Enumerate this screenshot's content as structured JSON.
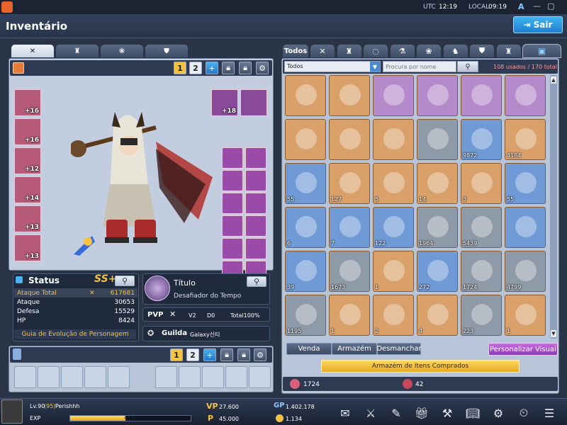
{
  "topbar": {
    "utc_label": "UTC",
    "utc_time": "12:19",
    "local_label": "LOCAL",
    "local_time": "09:19",
    "font_btn": "A"
  },
  "header": {
    "title": "Inventário",
    "exit_label": "Sair"
  },
  "equip": {
    "tabs": [
      "sword-icon",
      "armor-icon",
      "paw-icon",
      "shield-icon"
    ],
    "pages": [
      "1",
      "2"
    ],
    "left_slots": [
      "+16",
      "+16",
      "+12",
      "+14",
      "+13",
      "+13"
    ],
    "top_slots": [
      "+18",
      ""
    ],
    "right_slots": [
      "",
      "",
      "",
      "",
      "",
      "",
      "",
      "",
      "",
      "",
      "",
      ""
    ]
  },
  "status": {
    "title": "Status",
    "rank": "SS+",
    "rows": [
      {
        "label": "Ataque Total",
        "value": "617681"
      },
      {
        "label": "Ataque",
        "value": "30653"
      },
      {
        "label": "Defesa",
        "value": "15529"
      },
      {
        "label": "HP",
        "value": "8424"
      }
    ],
    "evolution": "Guia de Evolução de Personagem"
  },
  "titlebox": {
    "label": "Título",
    "value": "Desafiador do Tempo"
  },
  "pvp": {
    "label": "PVP",
    "rank": "V2",
    "d0": "D0",
    "total": "Total100%"
  },
  "guild": {
    "label": "Guilda",
    "name": "Galaxy신티"
  },
  "bottompanel": {
    "pages": [
      "1",
      "2"
    ]
  },
  "inventory": {
    "tabs": [
      "Todos",
      "sword-icon",
      "armor-icon",
      "ring-icon",
      "potion-icon",
      "paw-icon",
      "pet-icon",
      "shield-icon",
      "armor2-icon"
    ],
    "filter": "Todos",
    "search_placeholder": "Procura por nome",
    "usage": "108 usados / 170 total",
    "items": [
      {
        "qty": "",
        "bg": "#d9a06a"
      },
      {
        "qty": "",
        "bg": "#d9a06a"
      },
      {
        "qty": "",
        "bg": "#b48acb"
      },
      {
        "qty": "",
        "bg": "#b48acb"
      },
      {
        "qty": "",
        "bg": "#b48acb"
      },
      {
        "qty": "",
        "bg": "#b48acb"
      },
      {
        "qty": "",
        "bg": "#d9a06a"
      },
      {
        "qty": "",
        "bg": "#d9a06a"
      },
      {
        "qty": "",
        "bg": "#d9a06a"
      },
      {
        "qty": "",
        "bg": "#8f9aa8"
      },
      {
        "qty": "9872",
        "bg": "#6f9ad6"
      },
      {
        "qty": "4184",
        "bg": "#d9a06a"
      },
      {
        "qty": "55",
        "bg": "#6f9ad6"
      },
      {
        "qty": "127",
        "bg": "#d9a06a"
      },
      {
        "qty": "5",
        "bg": "#d9a06a"
      },
      {
        "qty": "14",
        "bg": "#d9a06a"
      },
      {
        "qty": "3",
        "bg": "#d9a06a"
      },
      {
        "qty": "55",
        "bg": "#6f9ad6"
      },
      {
        "qty": "6",
        "bg": "#6f9ad6"
      },
      {
        "qty": "7",
        "bg": "#6f9ad6"
      },
      {
        "qty": "122",
        "bg": "#6f9ad6"
      },
      {
        "qty": "1964",
        "bg": "#8f9aa8"
      },
      {
        "qty": "5439",
        "bg": "#8f9aa8"
      },
      {
        "qty": "",
        "bg": "#6f9ad6"
      },
      {
        "qty": "39",
        "bg": "#6f9ad6"
      },
      {
        "qty": "1673",
        "bg": "#8f9aa8"
      },
      {
        "qty": "1",
        "bg": "#d9a06a"
      },
      {
        "qty": "272",
        "bg": "#6f9ad6"
      },
      {
        "qty": "1724",
        "bg": "#8f9aa8"
      },
      {
        "qty": "4799",
        "bg": "#8f9aa8"
      },
      {
        "qty": "1195",
        "bg": "#8f9aa8"
      },
      {
        "qty": "1",
        "bg": "#d9a06a"
      },
      {
        "qty": "2",
        "bg": "#d9a06a"
      },
      {
        "qty": "4",
        "bg": "#d9a06a"
      },
      {
        "qty": "223",
        "bg": "#8f9aa8"
      },
      {
        "qty": "1",
        "bg": "#d9a06a"
      }
    ],
    "btn_sell": "Venda",
    "btn_storage": "Armazém",
    "btn_dismantle": "Desmanchar",
    "btn_visual": "Personalizar Visual",
    "bought_storage": "Armazém de Itens Comprados",
    "currency1": "1724",
    "currency2": "42"
  },
  "footer": {
    "level": "Lv.90",
    "level_bonus": "(95)",
    "name": "Perishhh",
    "exp_label": "EXP",
    "exp_value": "45.9",
    "exp_fraction": 0.459,
    "vp_label": "VP",
    "vp_value": "27.600",
    "gp_label": "GP",
    "gp_value": "1.402.178",
    "p_label": "P",
    "p_value": "45.000",
    "c_value": "1.134",
    "icons": [
      "mail-icon",
      "swords-icon",
      "quest-icon",
      "gift-icon",
      "hammer-icon",
      "book-icon",
      "skill-icon",
      "coupon-icon",
      "menu-icon"
    ]
  },
  "colors": {
    "accent": "#1e7fd0",
    "gold": "#f5c242",
    "bg": "#2a3447"
  }
}
